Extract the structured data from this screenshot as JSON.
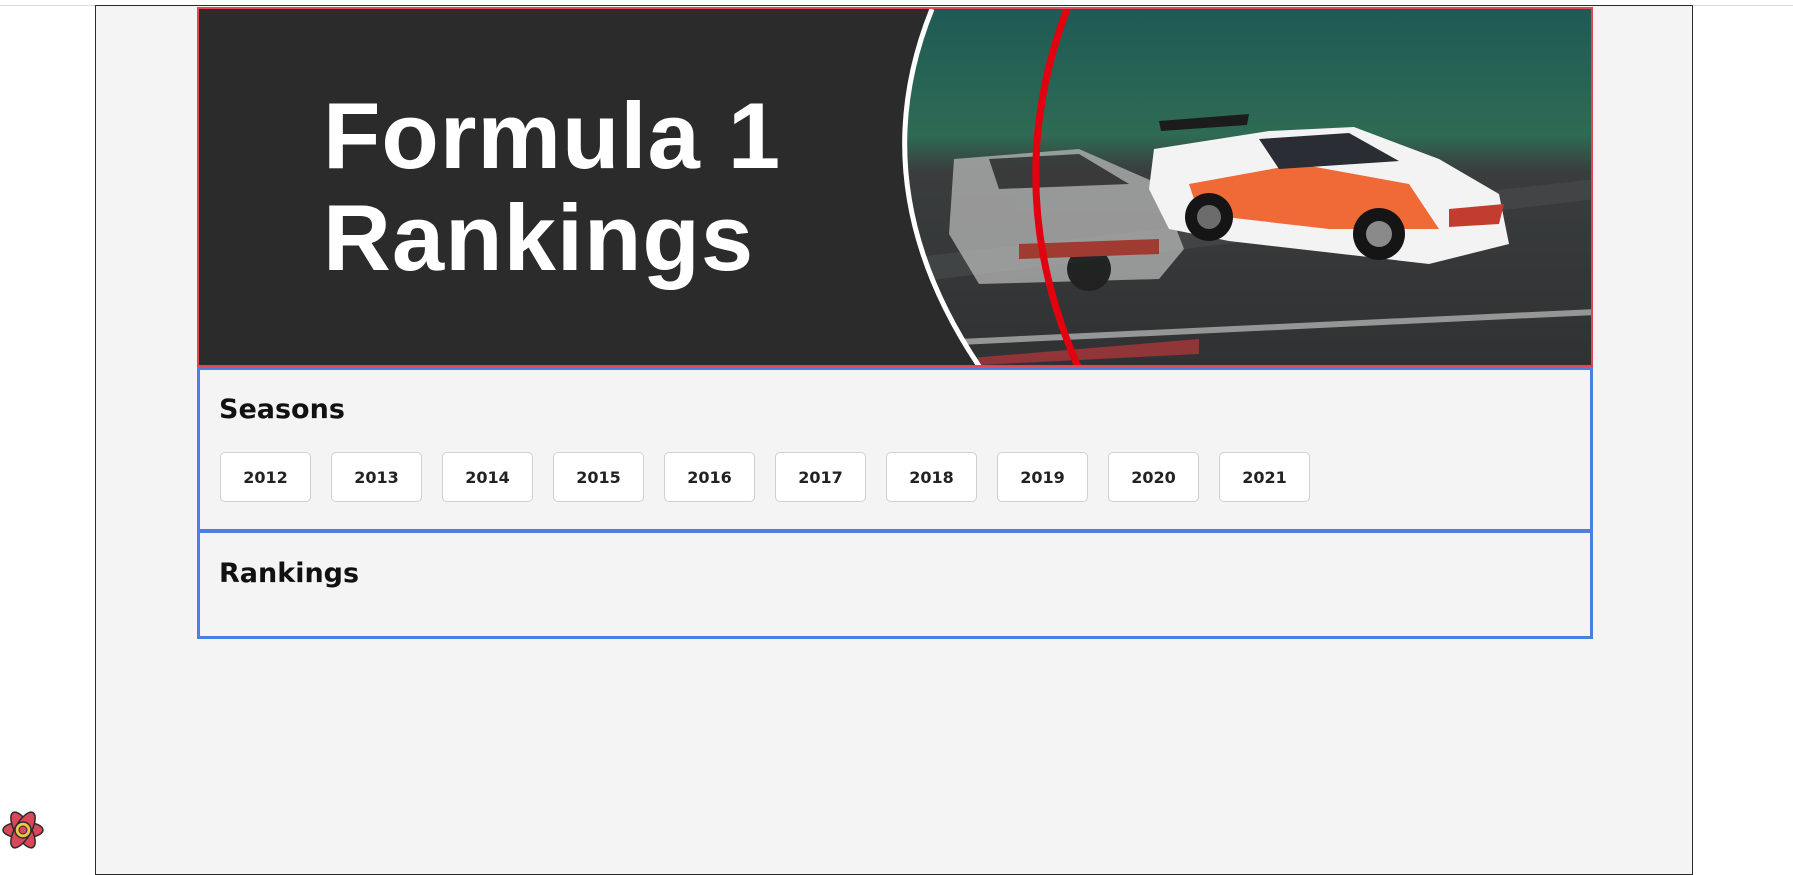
{
  "banner": {
    "title_line1": "Formula 1",
    "title_line2": "Rankings",
    "colors": {
      "background": "#2b2b2b",
      "border": "#e2474f",
      "accent_stripe": "#e3000f"
    }
  },
  "seasons": {
    "heading": "Seasons",
    "years": [
      "2012",
      "2013",
      "2014",
      "2015",
      "2016",
      "2017",
      "2018",
      "2019",
      "2020",
      "2021"
    ]
  },
  "rankings": {
    "heading": "Rankings"
  },
  "devtools": {
    "icon": "react-devtools-icon"
  },
  "colors": {
    "section_border": "#4b7fe0",
    "page_background": "#f4f4f4"
  }
}
